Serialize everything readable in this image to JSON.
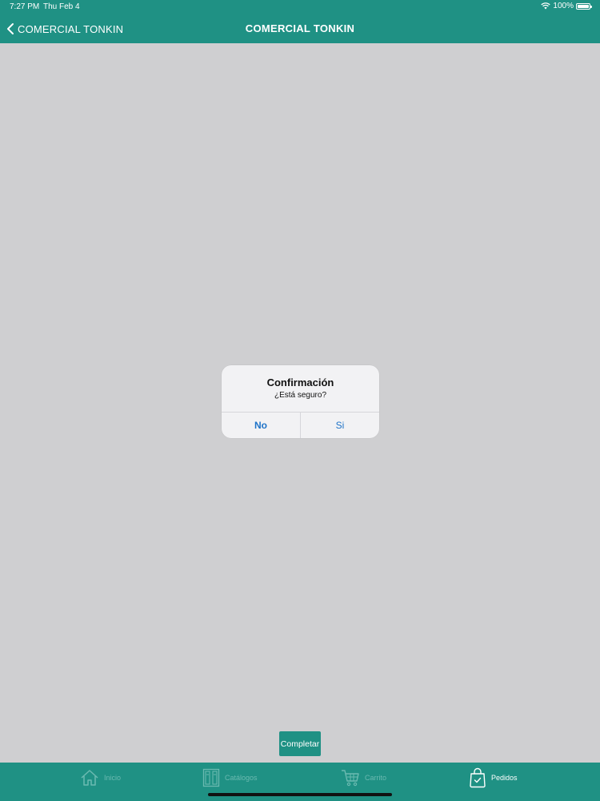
{
  "status_bar": {
    "time": "7:27 PM",
    "date": "Thu Feb 4",
    "battery": "100%",
    "icons": [
      "wifi-icon",
      "battery-icon"
    ]
  },
  "nav": {
    "back_label": "COMERCIAL TONKIN",
    "title": "COMERCIAL TONKIN",
    "back_icon": "chevron-left-icon"
  },
  "alert": {
    "title": "Confirmación",
    "message": "¿Está seguro?",
    "buttons": {
      "no": "No",
      "si": "Si"
    }
  },
  "complete_button": {
    "label": "Completar"
  },
  "tabs": [
    {
      "label": "Inicio",
      "icon": "home-icon",
      "active": false
    },
    {
      "label": "Catálogos",
      "icon": "catalog-icon",
      "active": false
    },
    {
      "label": "Carrito",
      "icon": "cart-icon",
      "active": false
    },
    {
      "label": "Pedidos",
      "icon": "shopping-bag-icon",
      "active": true
    }
  ],
  "colors": {
    "brand": "#1f9184",
    "background": "#cfcfd1",
    "alert_button": "#1e73c8",
    "tab_inactive": "#6bbab1",
    "tab_active": "#ffffff"
  }
}
